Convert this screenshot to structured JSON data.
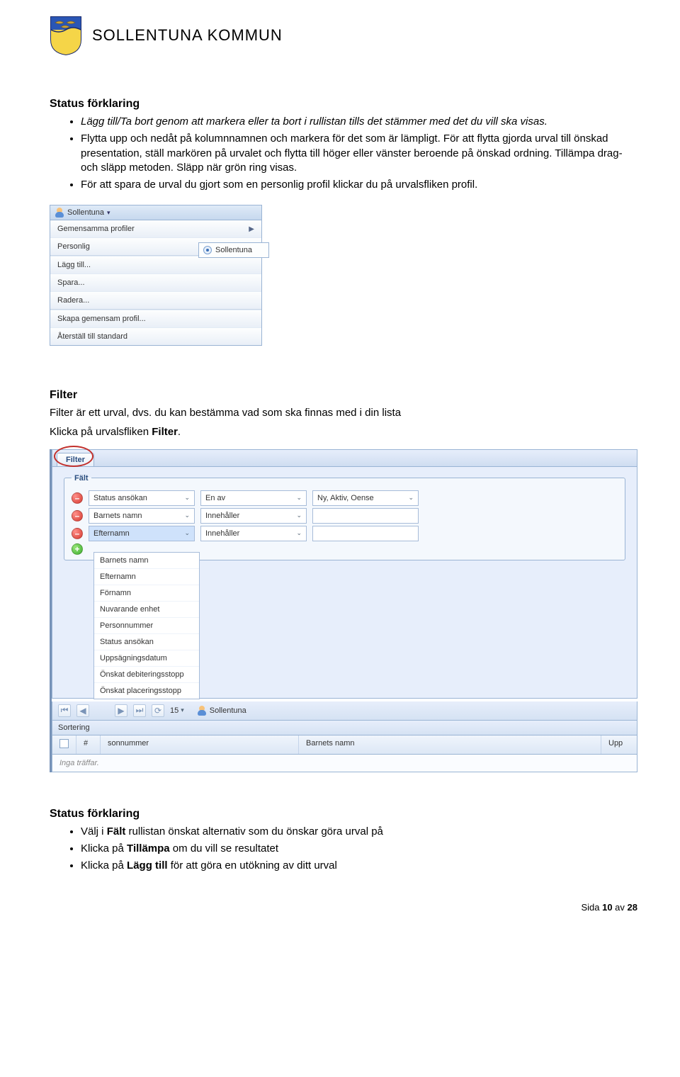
{
  "header": {
    "brand": "SOLLENTUNA KOMMUN"
  },
  "sec1": {
    "heading": "Status förklaring",
    "bullets": [
      "Lägg till/Ta bort genom att markera eller ta bort i rullistan tills det stämmer med det du vill ska visas.",
      "Flytta upp och nedåt på kolumnnamnen och markera för det som är lämpligt. För att flytta gjorda urval till önskad presentation, ställ markören på urvalet och flytta till höger eller vänster beroende på önskad ordning. Tillämpa drag- och släpp metoden. Släpp när grön ring visas.",
      "För att spara de urval du gjort som en personlig profil klickar du på urvalsfliken profil."
    ]
  },
  "shot1": {
    "toolbar_label": "Sollentuna",
    "menu": {
      "row1": "Gemensamma profiler",
      "row2": "Personlig",
      "row3": "Lägg till...",
      "row4": "Spara...",
      "row5": "Radera...",
      "row6": "Skapa gemensam profil...",
      "row7": "Återställ till standard"
    },
    "submenu": "Sollentuna"
  },
  "sec_filter": {
    "heading": "Filter",
    "line1a": "Filter är ett urval, dvs. du kan bestämma vad som ska finnas med i din lista",
    "line2_pre": "Klicka på urvalsfliken ",
    "line2_bold": "Filter",
    "line2_post": "."
  },
  "shot2": {
    "tab": "Filter",
    "legend": "Fält",
    "rows": [
      {
        "field": "Status ansökan",
        "op": "En av",
        "val": "Ny, Aktiv, Oense"
      },
      {
        "field": "Barnets namn",
        "op": "Innehåller",
        "val": ""
      },
      {
        "field": "Efternamn",
        "op": "Innehåller",
        "val": ""
      }
    ],
    "dropdown_options": [
      "Barnets namn",
      "Efternamn",
      "Förnamn",
      "Nuvarande enhet",
      "Personnummer",
      "Status ansökan",
      "Uppsägningsdatum",
      "Önskat debiteringsstopp",
      "Önskat placeringsstopp"
    ],
    "pager": {
      "page_size": "15",
      "sollentuna": "Sollentuna"
    },
    "sort_label": "Sortering",
    "columns": {
      "hash": "#",
      "c1": "sonnummer",
      "c2": "Barnets namn",
      "c3": "Upp"
    },
    "nohits": "Inga träffar."
  },
  "sec2": {
    "heading": "Status förklaring",
    "b1_pre": "Välj i ",
    "b1_bold": "Fält",
    "b1_post": " rullistan önskat alternativ som du önskar göra urval på",
    "b2_pre": "Klicka på ",
    "b2_bold": "Tillämpa",
    "b2_post": " om du vill se resultatet",
    "b3_pre": "Klicka på ",
    "b3_bold": "Lägg till",
    "b3_post": " för att göra en utökning av ditt urval"
  },
  "footer": {
    "pre": "Sida ",
    "num": "10",
    "mid": " av ",
    "total": "28"
  }
}
